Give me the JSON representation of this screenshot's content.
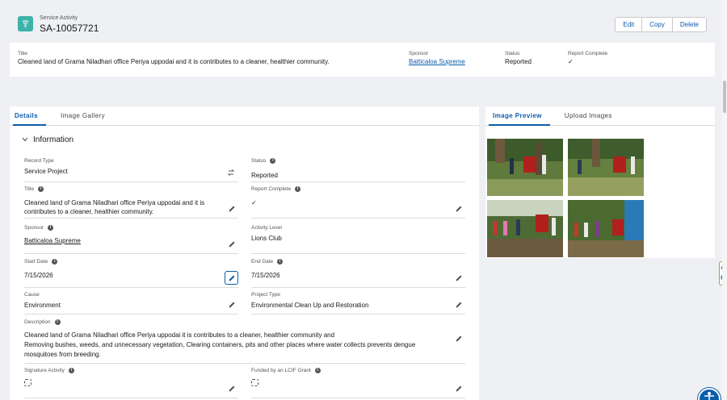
{
  "header": {
    "object_type": "Service Activity",
    "record_number": "SA-10057721",
    "actions": {
      "edit": "Edit",
      "copy": "Copy",
      "delete": "Delete"
    }
  },
  "highlights": {
    "title_label": "Title",
    "title_value": "Cleaned land of Grama Niladhari office Periya uppodai and it is contributes to a cleaner, healthier community.",
    "sponsor_label": "Sponsor",
    "sponsor_value": "Batticaloa Supreme",
    "status_label": "Status",
    "status_value": "Reported",
    "report_complete_label": "Report Complete",
    "report_complete_value": "✓"
  },
  "left_tabs": [
    "Details",
    "Image Gallery"
  ],
  "right_tabs": [
    "Image Preview",
    "Upload Images"
  ],
  "section": {
    "title": "Information"
  },
  "fields": {
    "record_type": {
      "label": "Record Type",
      "value": "Service Project"
    },
    "status": {
      "label": "Status",
      "value": "Reported"
    },
    "title": {
      "label": "Title",
      "value": "Cleaned land of Grama Niladhari office Periya uppodai and it is contributes to a cleaner, healthier community."
    },
    "report_complete": {
      "label": "Report Complete",
      "value": "✓"
    },
    "sponsor": {
      "label": "Sponsor",
      "value": "Batticaloa Supreme"
    },
    "activity_level": {
      "label": "Activity Level",
      "value": "Lions Club"
    },
    "start_date": {
      "label": "Start Date",
      "value": "7/15/2026"
    },
    "end_date": {
      "label": "End Date",
      "value": "7/15/2026"
    },
    "cause": {
      "label": "Cause",
      "value": "Environment"
    },
    "project_type": {
      "label": "Project Type",
      "value": "Environmental Clean Up and Restoration"
    },
    "description": {
      "label": "Description",
      "line1": "Cleaned land of Grama Niladhari office Periya uppodai it is contributes to a cleaner, healthier community and",
      "line2": "Removing bushes, weeds, and unnecessary vegetation, Clearing containers, pits and other places where water collects prevents dengue",
      "line3": "mosquitoes from breeding."
    },
    "signature_activity": {
      "label": "Signature Activity"
    },
    "funded_lcif": {
      "label": "Funded by an LCIF Grant"
    }
  },
  "colors": {
    "accent": "#0b5cab",
    "brand_icon": "#3bb3a8"
  }
}
